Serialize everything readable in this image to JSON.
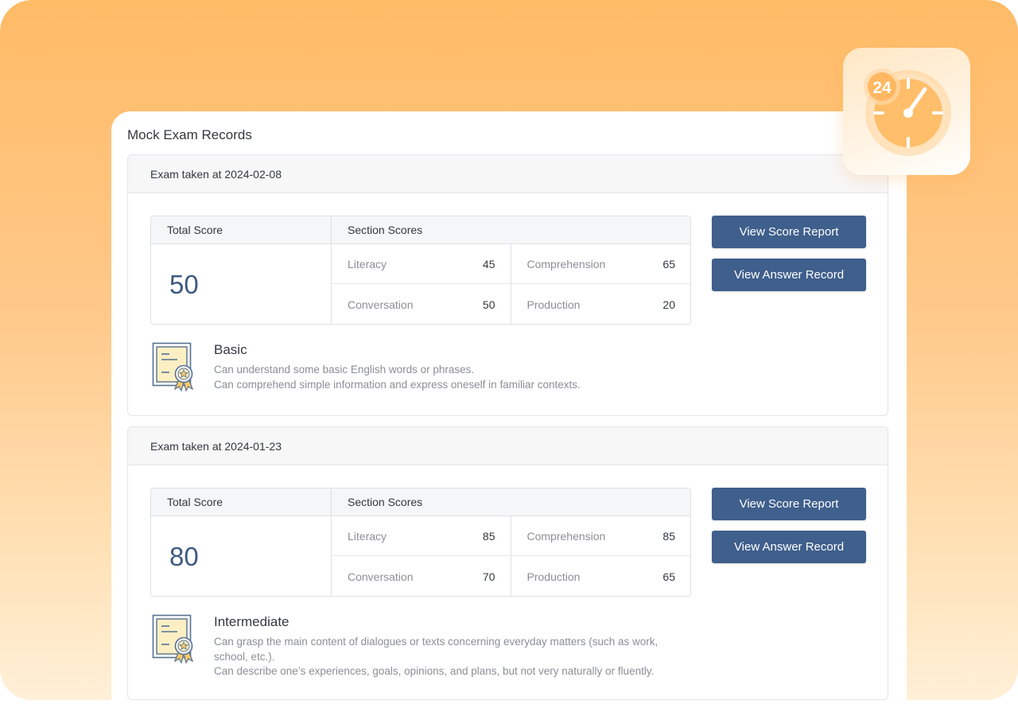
{
  "panel": {
    "title": "Mock Exam Records"
  },
  "labels": {
    "total_score": "Total Score",
    "section_scores": "Section Scores"
  },
  "records": [
    {
      "header": "Exam taken at 2024-02-08",
      "total": "50",
      "sections": [
        {
          "name": "Literacy",
          "score": "45"
        },
        {
          "name": "Comprehension",
          "score": "65"
        },
        {
          "name": "Conversation",
          "score": "50"
        },
        {
          "name": "Production",
          "score": "20"
        }
      ],
      "buttons": {
        "score_report": "View Score Report",
        "answer_record": "View Answer Record"
      },
      "level": {
        "title": "Basic",
        "lines": [
          "Can understand some basic English words or phrases.",
          "Can comprehend simple information and express oneself in familiar contexts."
        ]
      }
    },
    {
      "header": "Exam taken at 2024-01-23",
      "total": "80",
      "sections": [
        {
          "name": "Literacy",
          "score": "85"
        },
        {
          "name": "Comprehension",
          "score": "85"
        },
        {
          "name": "Conversation",
          "score": "70"
        },
        {
          "name": "Production",
          "score": "65"
        }
      ],
      "buttons": {
        "score_report": "View Score Report",
        "answer_record": "View Answer Record"
      },
      "level": {
        "title": "Intermediate",
        "lines": [
          "Can grasp the main content of dialogues or texts concerning everyday matters (such as work, school, etc.).",
          "Can describe one’s experiences, goals, opinions, and plans, but not very naturally or fluently."
        ]
      }
    }
  ],
  "badge": {
    "number": "24",
    "icon": "clock-24-icon"
  },
  "colors": {
    "accent": "#3f5f8c",
    "score": "#3d5a80",
    "background": "#ffbb66"
  }
}
